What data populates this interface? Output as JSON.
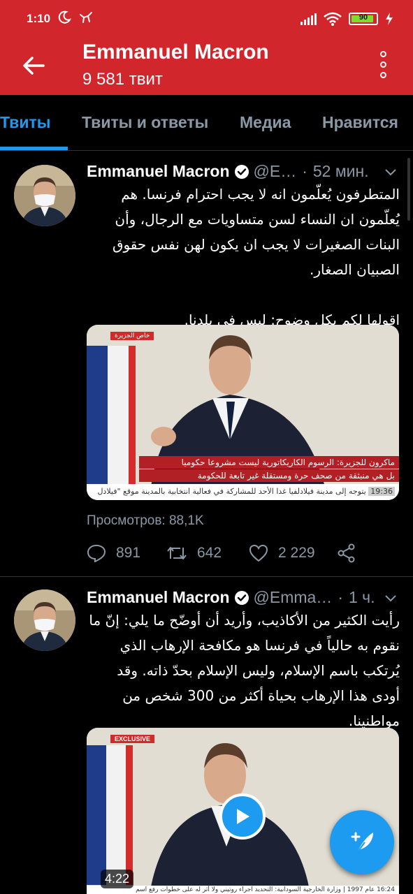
{
  "status_bar": {
    "time": "1:10",
    "battery": "90",
    "battery_level": 0.9
  },
  "header": {
    "title": "Emmanuel Macron",
    "subtitle": "9 581 твит"
  },
  "tabs": [
    {
      "label": "Твиты",
      "active": true
    },
    {
      "label": "Твиты и ответы",
      "active": false
    },
    {
      "label": "Медиа",
      "active": false
    },
    {
      "label": "Нравится",
      "active": false
    }
  ],
  "tweets": [
    {
      "name": "Emmanuel Macron",
      "handle": "@E…",
      "time": "52 мин.",
      "text": "المتطرفون يُعلّمون انه لا يجب احترام فرنسا. هم يُعلّمون ان النساء لسن متساويات مع الرجال، وأن البنات الصغيرات لا يجب ان يكون لهن نفس حقوق الصبيان الصغار.\n\nاقولها لكم بكل وضوح: ليس في بلدنا.",
      "media": {
        "badge": "خاص الجزيرة",
        "caption_line1": "ماكرون للجزيرة: الرسوم الكاريكاتورية ليست مشروعا حكوميا",
        "caption_line2": "بل هي منبثقة من صحف حرة ومستقلة غير تابعة للحكومة",
        "ticker_time": "19:36",
        "ticker_text": "يتوجه إلى مدينة فيلادلفيا غدا الأحد للمشاركة في فعالية انتخابية بالمدينة",
        "ticker_left": "موقع \"فيلادل"
      },
      "views": "Просмотров: 88,1K",
      "replies": "891",
      "retweets": "642",
      "likes": "2 229"
    },
    {
      "name": "Emmanuel Macron",
      "handle": "@Emma…",
      "time": "1 ч.",
      "text": "رأيت الكثير من الأكاذيب، وأريد أن أوضّح ما يلي: إنّ ما نقوم به حالياً في فرنسا هو مكافحة الإرهاب الذي يُرتكب باسم الإسلام، وليس الإسلام بحدّ ذاته. وقد أودى هذا الإرهاب بحياة أكثر من 300 شخص من مواطنينا.",
      "media": {
        "badge": "EXCLUSIVE",
        "duration": "4:22",
        "ticker_text": "16:24 عام 1997 | وزارة الخارجية السودانية: التحديد اجراء روتيني ولا أثر له على خطوات رفع اسم"
      }
    }
  ]
}
